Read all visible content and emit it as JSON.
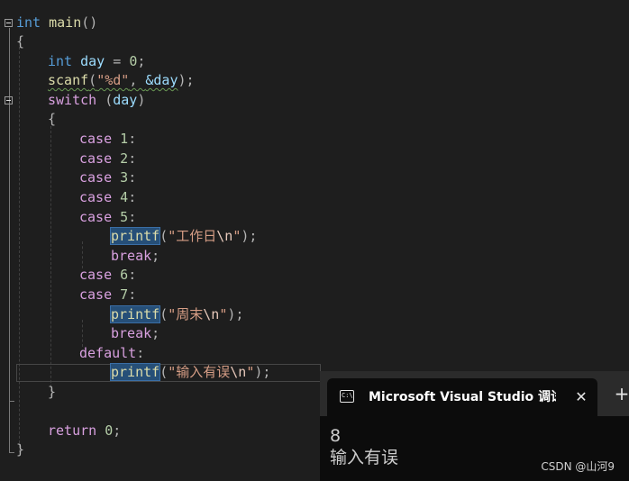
{
  "editor": {
    "lines": {
      "l1": {
        "kw_int": "int",
        "fn_main": "main",
        "parens": "()"
      },
      "l2": {
        "brace": "{"
      },
      "l3": {
        "kw_int": "int",
        "var_day": "day",
        "eq": " = ",
        "num": "0",
        "semi": ";"
      },
      "l4": {
        "fn_scanf": "scanf",
        "open": "(",
        "fmt": "\"%d\"",
        "comma": ", ",
        "amp_day": "&day",
        "close": ");"
      },
      "l5": {
        "kw_switch": "switch",
        "open": " (",
        "var_day": "day",
        "close": ")"
      },
      "l6": {
        "brace": "{"
      },
      "l7": {
        "kw_case": "case",
        "val": " 1",
        "colon": ":"
      },
      "l8": {
        "kw_case": "case",
        "val": " 2",
        "colon": ":"
      },
      "l9": {
        "kw_case": "case",
        "val": " 3",
        "colon": ":"
      },
      "l10": {
        "kw_case": "case",
        "val": " 4",
        "colon": ":"
      },
      "l11": {
        "kw_case": "case",
        "val": " 5",
        "colon": ":"
      },
      "l12": {
        "fn_printf": "printf",
        "open": "(",
        "str": "\"工作日",
        "esc": "\\n",
        "str_end": "\"",
        "close": ");"
      },
      "l13": {
        "kw_break": "break",
        "semi": ";"
      },
      "l14": {
        "kw_case": "case",
        "val": " 6",
        "colon": ":"
      },
      "l15": {
        "kw_case": "case",
        "val": " 7",
        "colon": ":"
      },
      "l16": {
        "fn_printf": "printf",
        "open": "(",
        "str": "\"周末",
        "esc": "\\n",
        "str_end": "\"",
        "close": ");"
      },
      "l17": {
        "kw_break": "break",
        "semi": ";"
      },
      "l18": {
        "kw_default": "default",
        "colon": ":"
      },
      "l19": {
        "fn_printf": "printf",
        "open": "(",
        "str": "\"输入有误",
        "esc": "\\n",
        "str_end": "\"",
        "close": ");"
      },
      "l20": {
        "brace": "}"
      },
      "l22": {
        "kw_return": "return",
        "val": " 0",
        "semi": ";"
      },
      "l23": {
        "brace": "}"
      }
    }
  },
  "console": {
    "tab_title": "Microsoft Visual Studio 调试控制台",
    "icon_glyph": "C:\\",
    "close_glyph": "✕",
    "newtab_glyph": "+",
    "output": [
      "8",
      "输入有误"
    ]
  },
  "watermark": "CSDN @山河9"
}
